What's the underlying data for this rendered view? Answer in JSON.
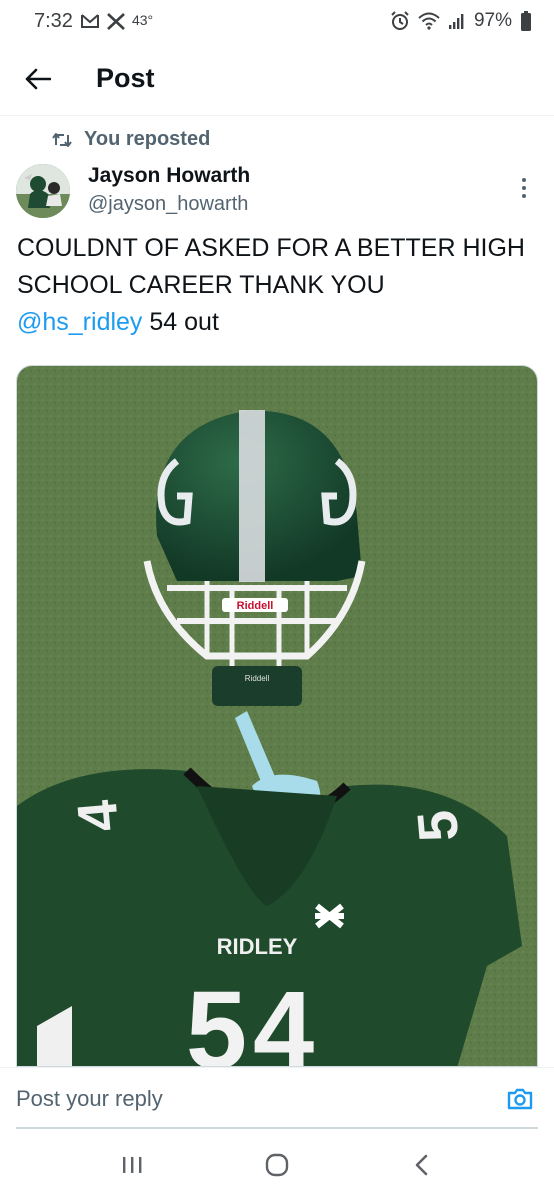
{
  "status_bar": {
    "time": "7:32",
    "temperature": "43°",
    "battery": "97%",
    "icons": [
      "gmail-icon",
      "x-icon",
      "alarm-icon",
      "wifi-icon",
      "signal-icon",
      "battery-icon"
    ]
  },
  "header": {
    "title": "Post",
    "back_icon": "arrow-left-icon"
  },
  "repost": {
    "label": "You reposted",
    "icon": "repost-icon"
  },
  "author": {
    "name": "Jayson Howarth",
    "handle": "@jayson_howarth"
  },
  "post": {
    "text_line": "COULDNT OF ASKED FOR A BETTER HIGH SCHOOL CAREER THANK YOU",
    "mention": "@hs_ridley",
    "text_after": " 54 out"
  },
  "media": {
    "description_texts": {
      "helmet_brand": "Riddell",
      "helmet_brand_chin": "Riddell",
      "jersey_name": "RIDLEY",
      "jersey_number": "54",
      "sleeve_left": "4",
      "sleeve_right": "5"
    },
    "colors": {
      "turf": "#5f7d4a",
      "jersey": "#1f4a2c",
      "helmet": "#1b4d33",
      "facemask": "#f2f2f2",
      "mouthguard": "#a9dceb"
    }
  },
  "reply": {
    "placeholder": "Post your reply",
    "camera_icon": "camera-icon"
  },
  "nav_bar": {
    "recents_icon": "recents-icon",
    "home_icon": "home-icon",
    "back_icon": "back-chevron-icon"
  },
  "colors": {
    "accent": "#1d9bf0",
    "text_primary": "#0f1419",
    "text_secondary": "#536471"
  }
}
